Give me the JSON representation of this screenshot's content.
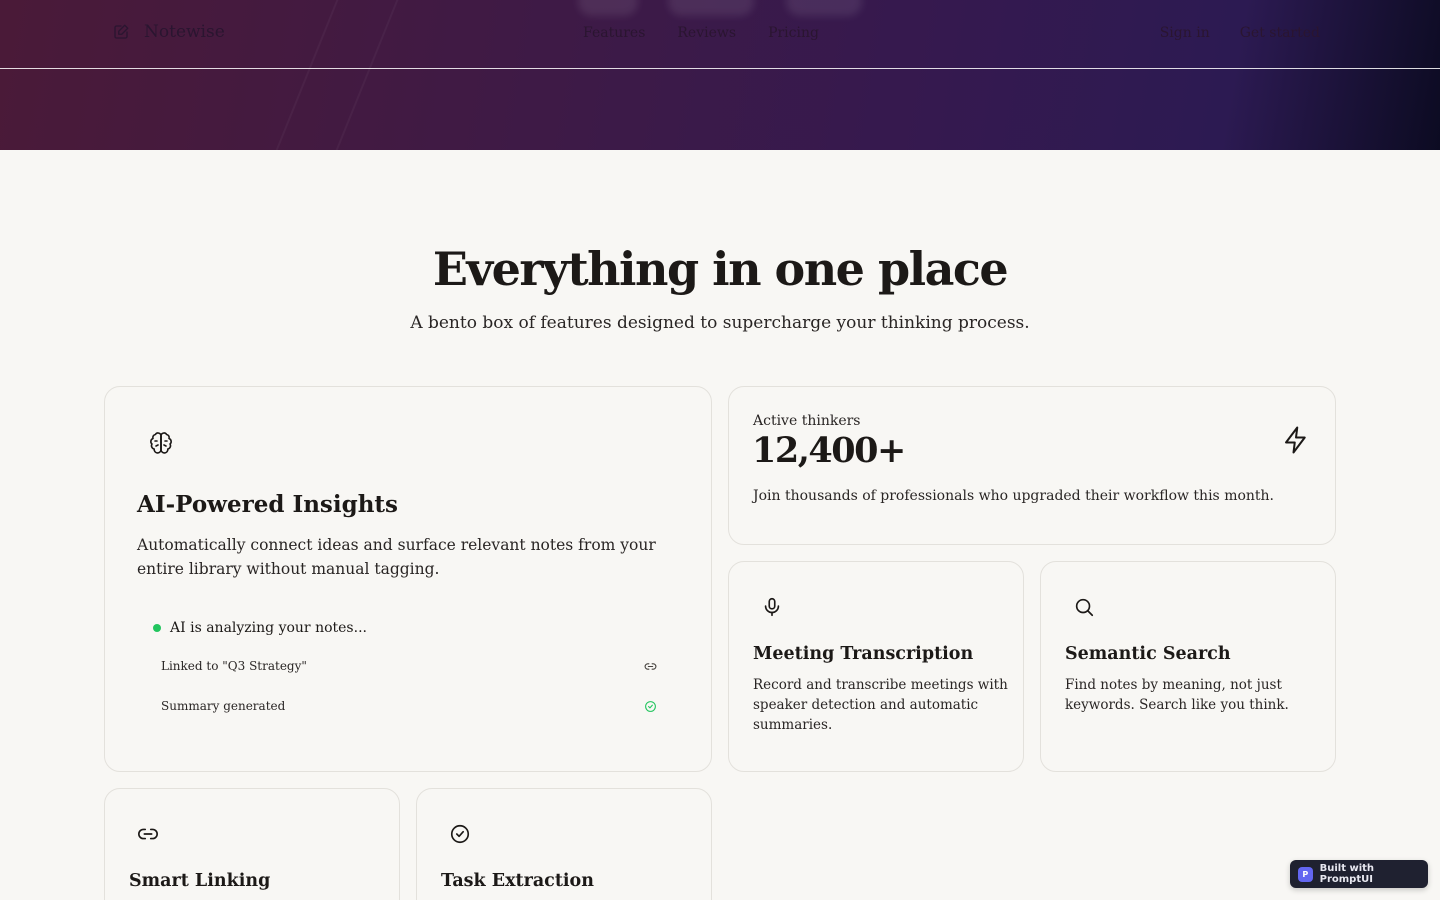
{
  "nav": {
    "brand": "Notewise",
    "links": [
      {
        "label": "Features"
      },
      {
        "label": "Reviews"
      },
      {
        "label": "Pricing"
      }
    ],
    "sign_in": "Sign in",
    "get_started": "Get started"
  },
  "section": {
    "title": "Everything in one place",
    "subtitle": "A bento box of features designed to supercharge your thinking process."
  },
  "cards": {
    "ai": {
      "icon": "brain-icon",
      "title": "AI-Powered Insights",
      "description": "Automatically connect ideas and surface relevant notes from your entire library without manual tagging.",
      "status": "AI is analyzing your notes...",
      "rows": [
        {
          "label": "Linked to \"Q3 Strategy\"",
          "icon": "link-icon"
        },
        {
          "label": "Summary generated",
          "icon": "check-circle-icon"
        }
      ]
    },
    "stats": {
      "label": "Active thinkers",
      "value": "12,400+",
      "description": "Join thousands of professionals who upgraded their workflow this month.",
      "icon": "bolt-icon"
    },
    "meeting": {
      "icon": "microphone-icon",
      "title": "Meeting Transcription",
      "description": "Record and transcribe meetings with speaker detection and automatic summaries."
    },
    "search": {
      "icon": "search-icon",
      "title": "Semantic Search",
      "description": "Find notes by meaning, not just keywords. Search like you think."
    },
    "linking": {
      "icon": "link-icon",
      "title": "Smart Linking"
    },
    "tasks": {
      "icon": "check-circle-icon",
      "title": "Task Extraction"
    }
  },
  "badge": {
    "logo_letter": "P",
    "text": "Built with PromptUI"
  },
  "colors": {
    "accent_green": "#22c55e",
    "hero_gradient_start": "#4a1a38",
    "hero_gradient_end": "#0c0b22",
    "badge_bg": "#1f2130",
    "badge_logo": "#6366f1"
  }
}
